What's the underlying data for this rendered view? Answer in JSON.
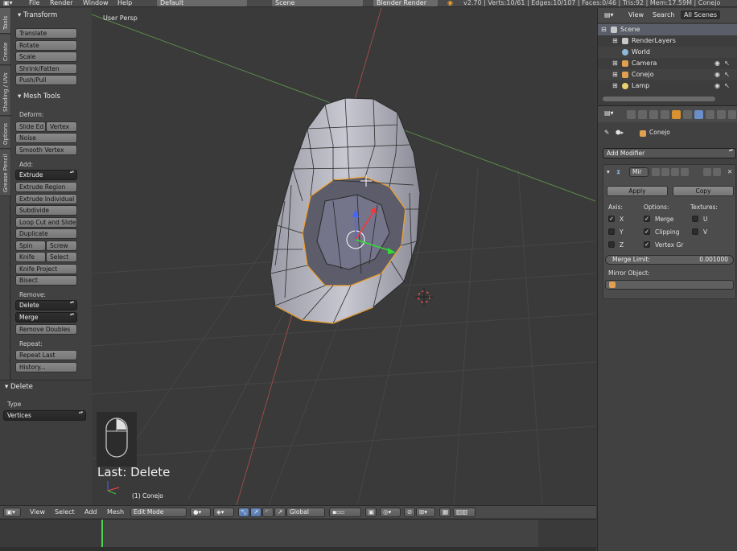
{
  "topbar": {
    "menus": [
      "File",
      "Render",
      "Window",
      "Help"
    ],
    "layout": "Default",
    "scene": "Scene",
    "engine": "Blender Render",
    "stats": "v2.70 | Verts:10/61 | Edges:10/107 | Faces:0/46 | Tris:92 | Mem:17.59M | Conejo"
  },
  "tabs": [
    "Tools",
    "Create",
    "Shading / UVs",
    "Options",
    "Grease Pencil"
  ],
  "shelf": {
    "transform_title": "Transform",
    "transform": [
      "Translate",
      "Rotate",
      "Scale",
      "Shrink/Fatten",
      "Push/Pull"
    ],
    "mesh_tools_title": "Mesh Tools",
    "deform_label": "Deform:",
    "slide_edge": "Slide Ed",
    "vertex": "Vertex",
    "noise": "Noise",
    "smooth_vertex": "Smooth Vertex",
    "add_label": "Add:",
    "extrude": "Extrude",
    "extrude_region": "Extrude Region",
    "extrude_individual": "Extrude Individual",
    "subdivide": "Subdivide",
    "loop_cut": "Loop Cut and Slide",
    "duplicate": "Duplicate",
    "spin": "Spin",
    "screw": "Screw",
    "knife": "Knife",
    "select": "Select",
    "knife_project": "Knife Project",
    "bisect": "Bisect",
    "remove_label": "Remove:",
    "delete": "Delete",
    "merge": "Merge",
    "remove_doubles": "Remove Doubles",
    "repeat_label": "Repeat:",
    "repeat_last": "Repeat Last",
    "history": "History..."
  },
  "operator": {
    "title": "Delete",
    "type_label": "Type",
    "type_value": "Vertices"
  },
  "viewport": {
    "label": "User Persp",
    "last_op": "Last: Delete",
    "object": "(1) Conejo"
  },
  "vp_header": {
    "view": "View",
    "select": "Select",
    "add": "Add",
    "mesh": "Mesh",
    "mode": "Edit Mode",
    "orientation": "Global"
  },
  "outliner": {
    "view": "View",
    "search": "Search",
    "filter": "All Scenes",
    "rows": [
      "Scene",
      "RenderLayers",
      "World",
      "Camera",
      "Conejo",
      "Lamp"
    ]
  },
  "properties": {
    "object": "Conejo",
    "add_modifier": "Add Modifier",
    "modifier_name": "Mir",
    "apply": "Apply",
    "copy": "Copy",
    "axis_label": "Axis:",
    "options_label": "Options:",
    "textures_label": "Textures:",
    "x": "X",
    "y": "Y",
    "z": "Z",
    "merge": "Merge",
    "clipping": "Clipping",
    "vertex_groups": "Vertex Gr",
    "u": "U",
    "v": "V",
    "merge_limit_label": "Merge Limit:",
    "merge_limit_value": "0.001000",
    "mirror_object_label": "Mirror Object:"
  },
  "colors": {
    "accent": "#5680c2",
    "selection": "#f0a030",
    "timeline_cursor": "#4fd24f"
  }
}
